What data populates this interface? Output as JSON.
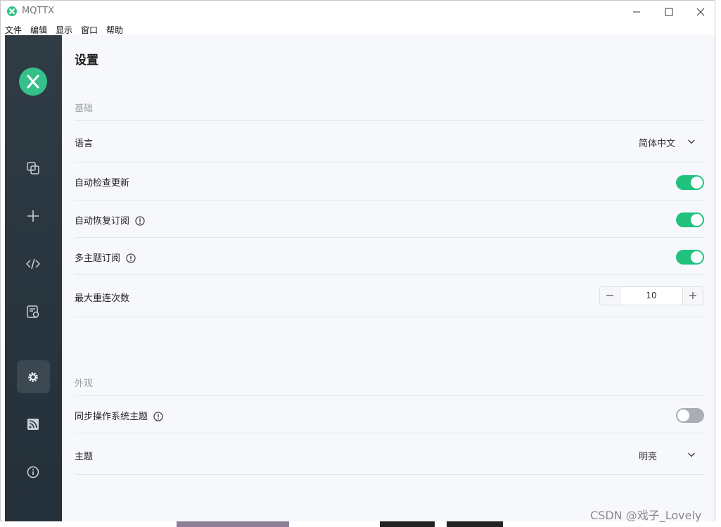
{
  "window": {
    "title": "MQTTX"
  },
  "menubar": {
    "items": [
      "文件",
      "编辑",
      "显示",
      "窗口",
      "帮助"
    ]
  },
  "sidebar": {
    "items": [
      {
        "name": "connections",
        "icon": "connections-icon"
      },
      {
        "name": "new-connection",
        "icon": "plus-icon"
      },
      {
        "name": "script",
        "icon": "code-icon"
      },
      {
        "name": "log",
        "icon": "log-icon"
      },
      {
        "name": "settings",
        "icon": "gear-icon",
        "active": true
      },
      {
        "name": "subscribe",
        "icon": "rss-icon"
      },
      {
        "name": "about",
        "icon": "info-icon"
      }
    ]
  },
  "settings": {
    "title": "设置",
    "basic": {
      "section_title": "基础",
      "language": {
        "label": "语言",
        "value": "简体中文"
      },
      "auto_check_update": {
        "label": "自动检查更新",
        "enabled": true
      },
      "auto_resubscribe": {
        "label": "自动恢复订阅",
        "enabled": true
      },
      "multi_topic_subscribe": {
        "label": "多主题订阅",
        "enabled": true
      },
      "max_reconnect": {
        "label": "最大重连次数",
        "value": "10"
      }
    },
    "appearance": {
      "section_title": "外观",
      "sync_os_theme": {
        "label": "同步操作系统主题",
        "enabled": false
      },
      "theme": {
        "label": "主题",
        "value": "明亮"
      }
    }
  },
  "watermark": "CSDN @戏子_Lovely",
  "colors": {
    "accent": "#20c27d",
    "sidebar": "#2a3740",
    "background": "#f7f8fc"
  }
}
